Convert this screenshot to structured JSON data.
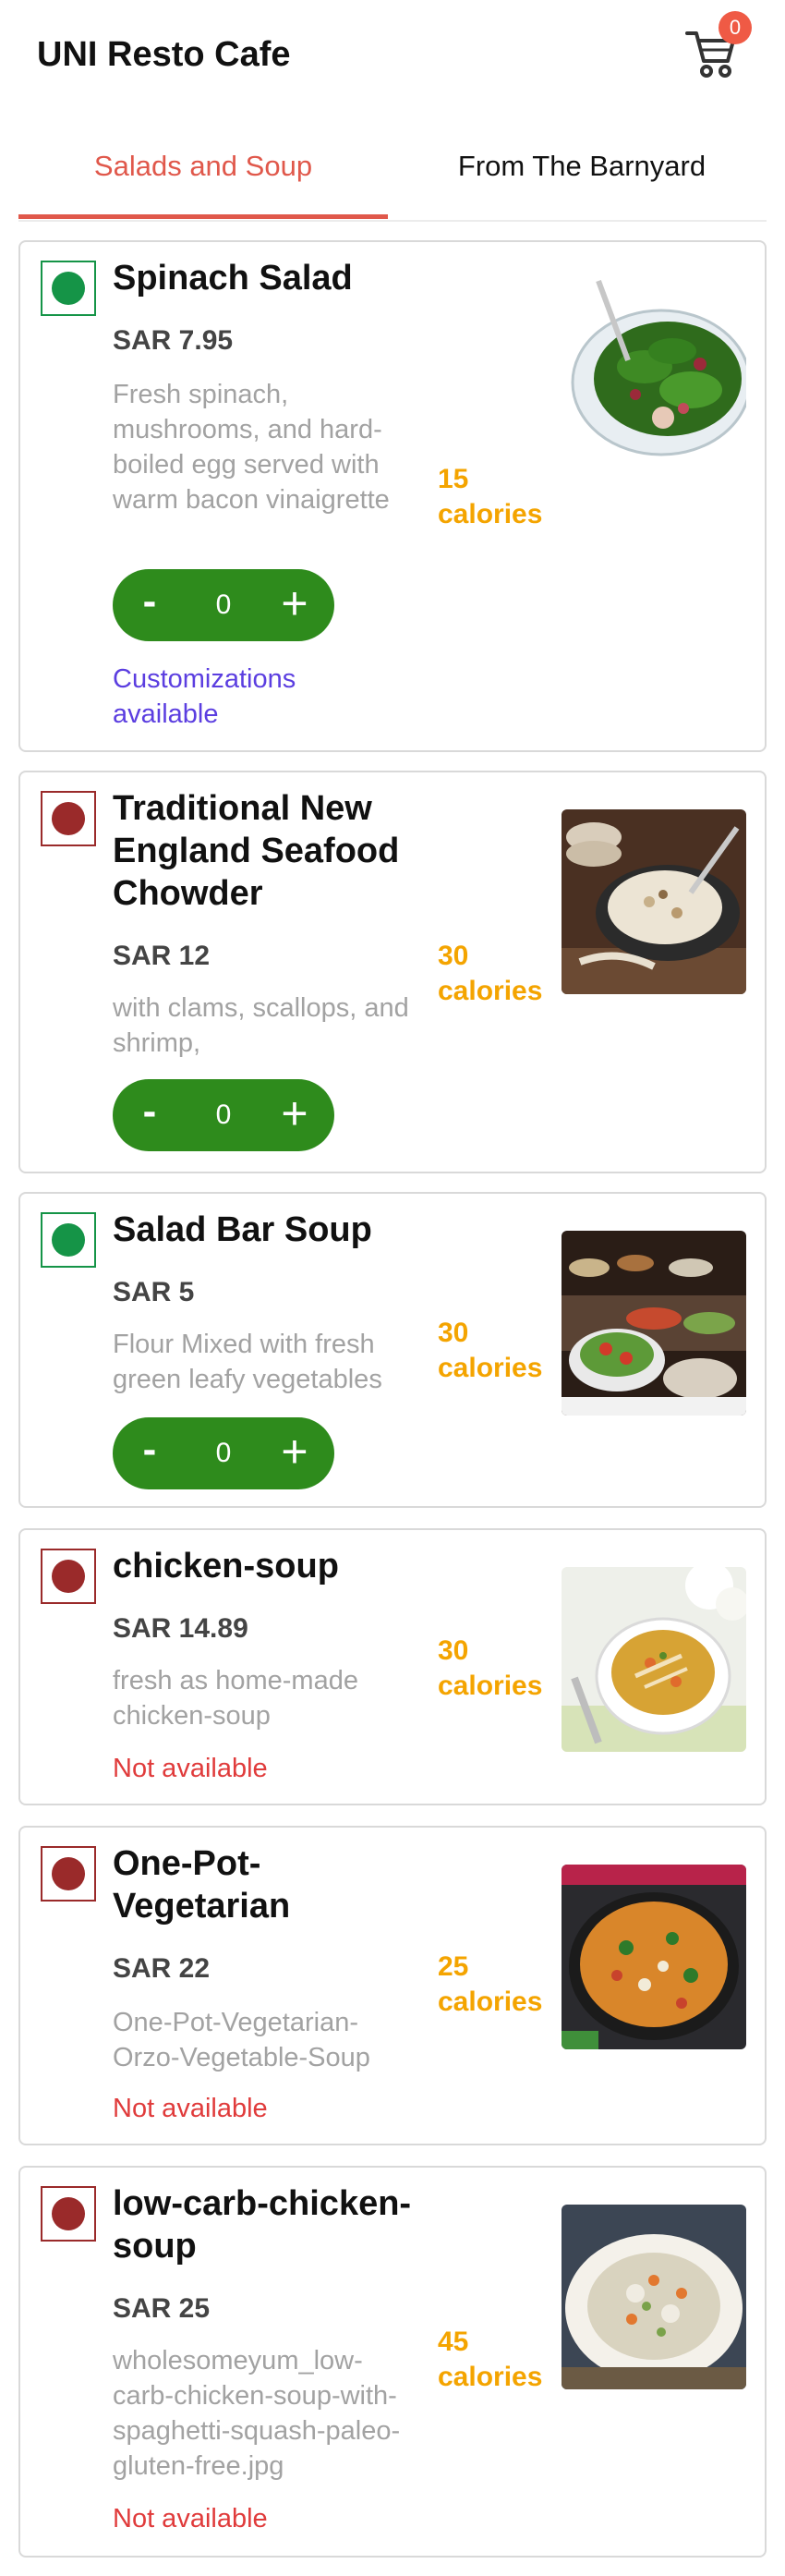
{
  "header": {
    "title": "UNI Resto Cafe",
    "cart_icon": "shopping-cart-icon",
    "cart_count": "0"
  },
  "tabs": [
    {
      "label": "Salads and Soup",
      "active": true
    },
    {
      "label": "From The Barnyard",
      "active": false
    }
  ],
  "colors": {
    "accent": "#e0584b",
    "veg": "#159447",
    "nonveg": "#9a2a2a",
    "stepper": "#2e8b1c",
    "calories": "#f4a400",
    "customizations": "#5b3ee0",
    "unavailable": "#e03b3b"
  },
  "items": [
    {
      "name": "Spinach Salad",
      "price": "SAR 7.95",
      "description": "Fresh spinach, mushrooms, and hard-boiled egg served with warm bacon vinaigrette",
      "calories": "15 calories",
      "diet": "veg",
      "quantity": "0",
      "stepper_minus": "-",
      "stepper_plus": "+",
      "customizations": "Customizations available",
      "photo": "spinach-salad-photo"
    },
    {
      "name": "Traditional New England Seafood Chowder",
      "price": "SAR 12",
      "description": "with clams, scallops, and shrimp,",
      "calories": "30 calories",
      "diet": "nonveg",
      "quantity": "0",
      "stepper_minus": "-",
      "stepper_plus": "+",
      "photo": "seafood-chowder-photo"
    },
    {
      "name": "Salad Bar Soup",
      "price": "SAR 5",
      "description": "Flour Mixed with fresh green leafy vegetables",
      "calories": "30 calories",
      "diet": "veg",
      "quantity": "0",
      "stepper_minus": "-",
      "stepper_plus": "+",
      "photo": "salad-bar-photo"
    },
    {
      "name": "chicken-soup",
      "price": "SAR 14.89",
      "description": "fresh as home-made chicken-soup",
      "calories": "30 calories",
      "diet": "nonveg",
      "status": "Not available",
      "photo": "chicken-soup-photo"
    },
    {
      "name": "One-Pot-Vegetarian",
      "price": "SAR 22",
      "description": "One-Pot-Vegetarian-Orzo-Vegetable-Soup",
      "calories": "25 calories",
      "diet": "nonveg",
      "status": "Not available",
      "photo": "one-pot-vegetarian-photo"
    },
    {
      "name": "low-carb-chicken-soup",
      "price": "SAR 25",
      "description": "wholesomeyum_low-carb-chicken-soup-with-spaghetti-squash-paleo-gluten-free.jpg",
      "calories": "45 calories",
      "diet": "nonveg",
      "status": "Not available",
      "photo": "low-carb-chicken-soup-photo"
    }
  ]
}
